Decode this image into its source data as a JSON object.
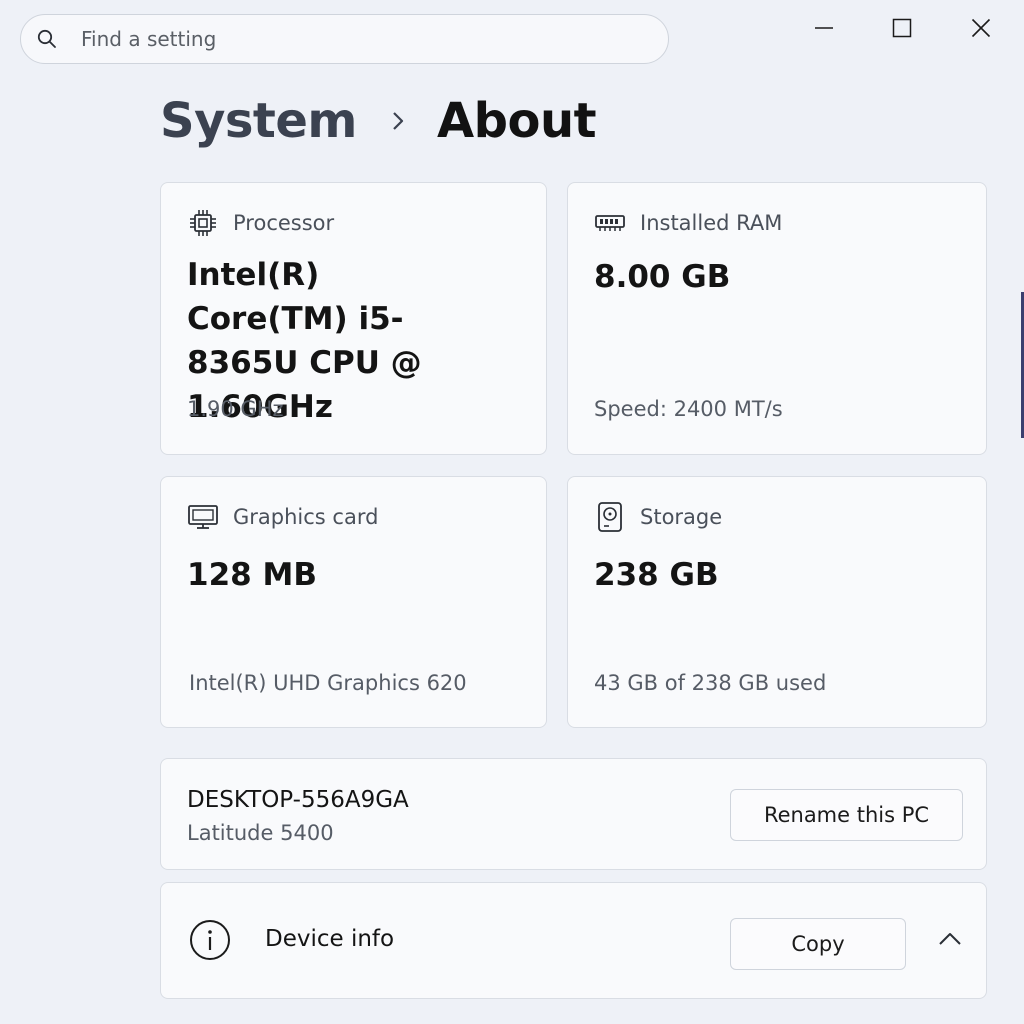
{
  "search": {
    "placeholder": "Find a setting"
  },
  "window_controls": {
    "minimize": "minimize-icon",
    "maximize": "maximize-icon",
    "close": "close-icon"
  },
  "breadcrumb": {
    "parent": "System",
    "current": "About"
  },
  "specs": {
    "processor": {
      "label": "Processor",
      "value": "Intel(R) Core(TM) i5-8365U CPU @ 1.60GHz",
      "sub": "1.90 GHz",
      "icon": "processor-icon"
    },
    "ram": {
      "label": "Installed RAM",
      "value": "8.00 GB",
      "sub": "Speed: 2400 MT/s",
      "icon": "ram-icon"
    },
    "graphics": {
      "label": "Graphics card",
      "value": "128 MB",
      "sub": "Intel(R) UHD Graphics 620",
      "icon": "monitor-icon"
    },
    "storage": {
      "label": "Storage",
      "value": "238 GB",
      "sub": "43 GB of 238 GB used",
      "icon": "storage-icon"
    }
  },
  "device": {
    "name": "DESKTOP-556A9GA",
    "model": "Latitude 5400",
    "rename_label": "Rename this PC"
  },
  "device_info": {
    "label": "Device info",
    "copy_label": "Copy",
    "icon": "info-icon",
    "expand_icon": "chevron-up-icon"
  },
  "colors": {
    "background": "#eef1f7",
    "card": "#f9fafc",
    "border": "#d9dde4",
    "text": "#1b1b1b",
    "secondary_text": "#565c66"
  }
}
